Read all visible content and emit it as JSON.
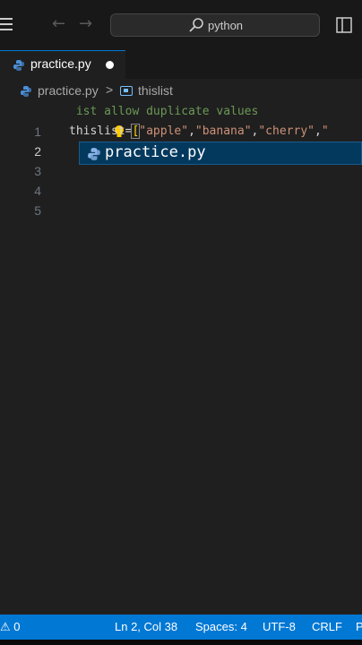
{
  "titlebar": {
    "search_text": "python"
  },
  "tab": {
    "filename": "practice.py",
    "modified": true
  },
  "breadcrumb": {
    "file": "practice.py",
    "separator": ">",
    "symbol": "thislist"
  },
  "editor": {
    "lines": [
      {
        "number": "1",
        "text": "#list allow duplicate values",
        "kind": "comment"
      },
      {
        "number": "2",
        "text": "thislist=[\"apple\",\"banana\",\"cherry\",\"",
        "kind": "code",
        "active": true
      },
      {
        "number": "3",
        "text": ""
      },
      {
        "number": "4",
        "text": ""
      },
      {
        "number": "5",
        "text": ""
      }
    ],
    "line2_parts": {
      "name": "thislist=",
      "bracket": "[",
      "s1": "\"apple\"",
      "c1": ",",
      "s2": "\"banana\"",
      "c2": ",",
      "s3": "\"cherry\"",
      "c3": ",",
      "s4": "\""
    },
    "comment_rest": "ist allow duplicate values"
  },
  "suggestion": {
    "label": "practice.py"
  },
  "statusbar": {
    "problems": "0",
    "position": "Ln 2, Col 38",
    "spaces": "Spaces: 4",
    "encoding": "UTF-8",
    "eol": "CRLF",
    "language_partial": "P"
  },
  "colors": {
    "accent": "#0078d4",
    "comment": "#6a9955",
    "string": "#ce9178"
  },
  "icons": [
    "menu-icon",
    "arrow-left-icon",
    "arrow-right-icon",
    "search-icon",
    "layout-icon",
    "python-icon",
    "symbol-variable-icon",
    "lightbulb-icon",
    "warning-icon"
  ]
}
